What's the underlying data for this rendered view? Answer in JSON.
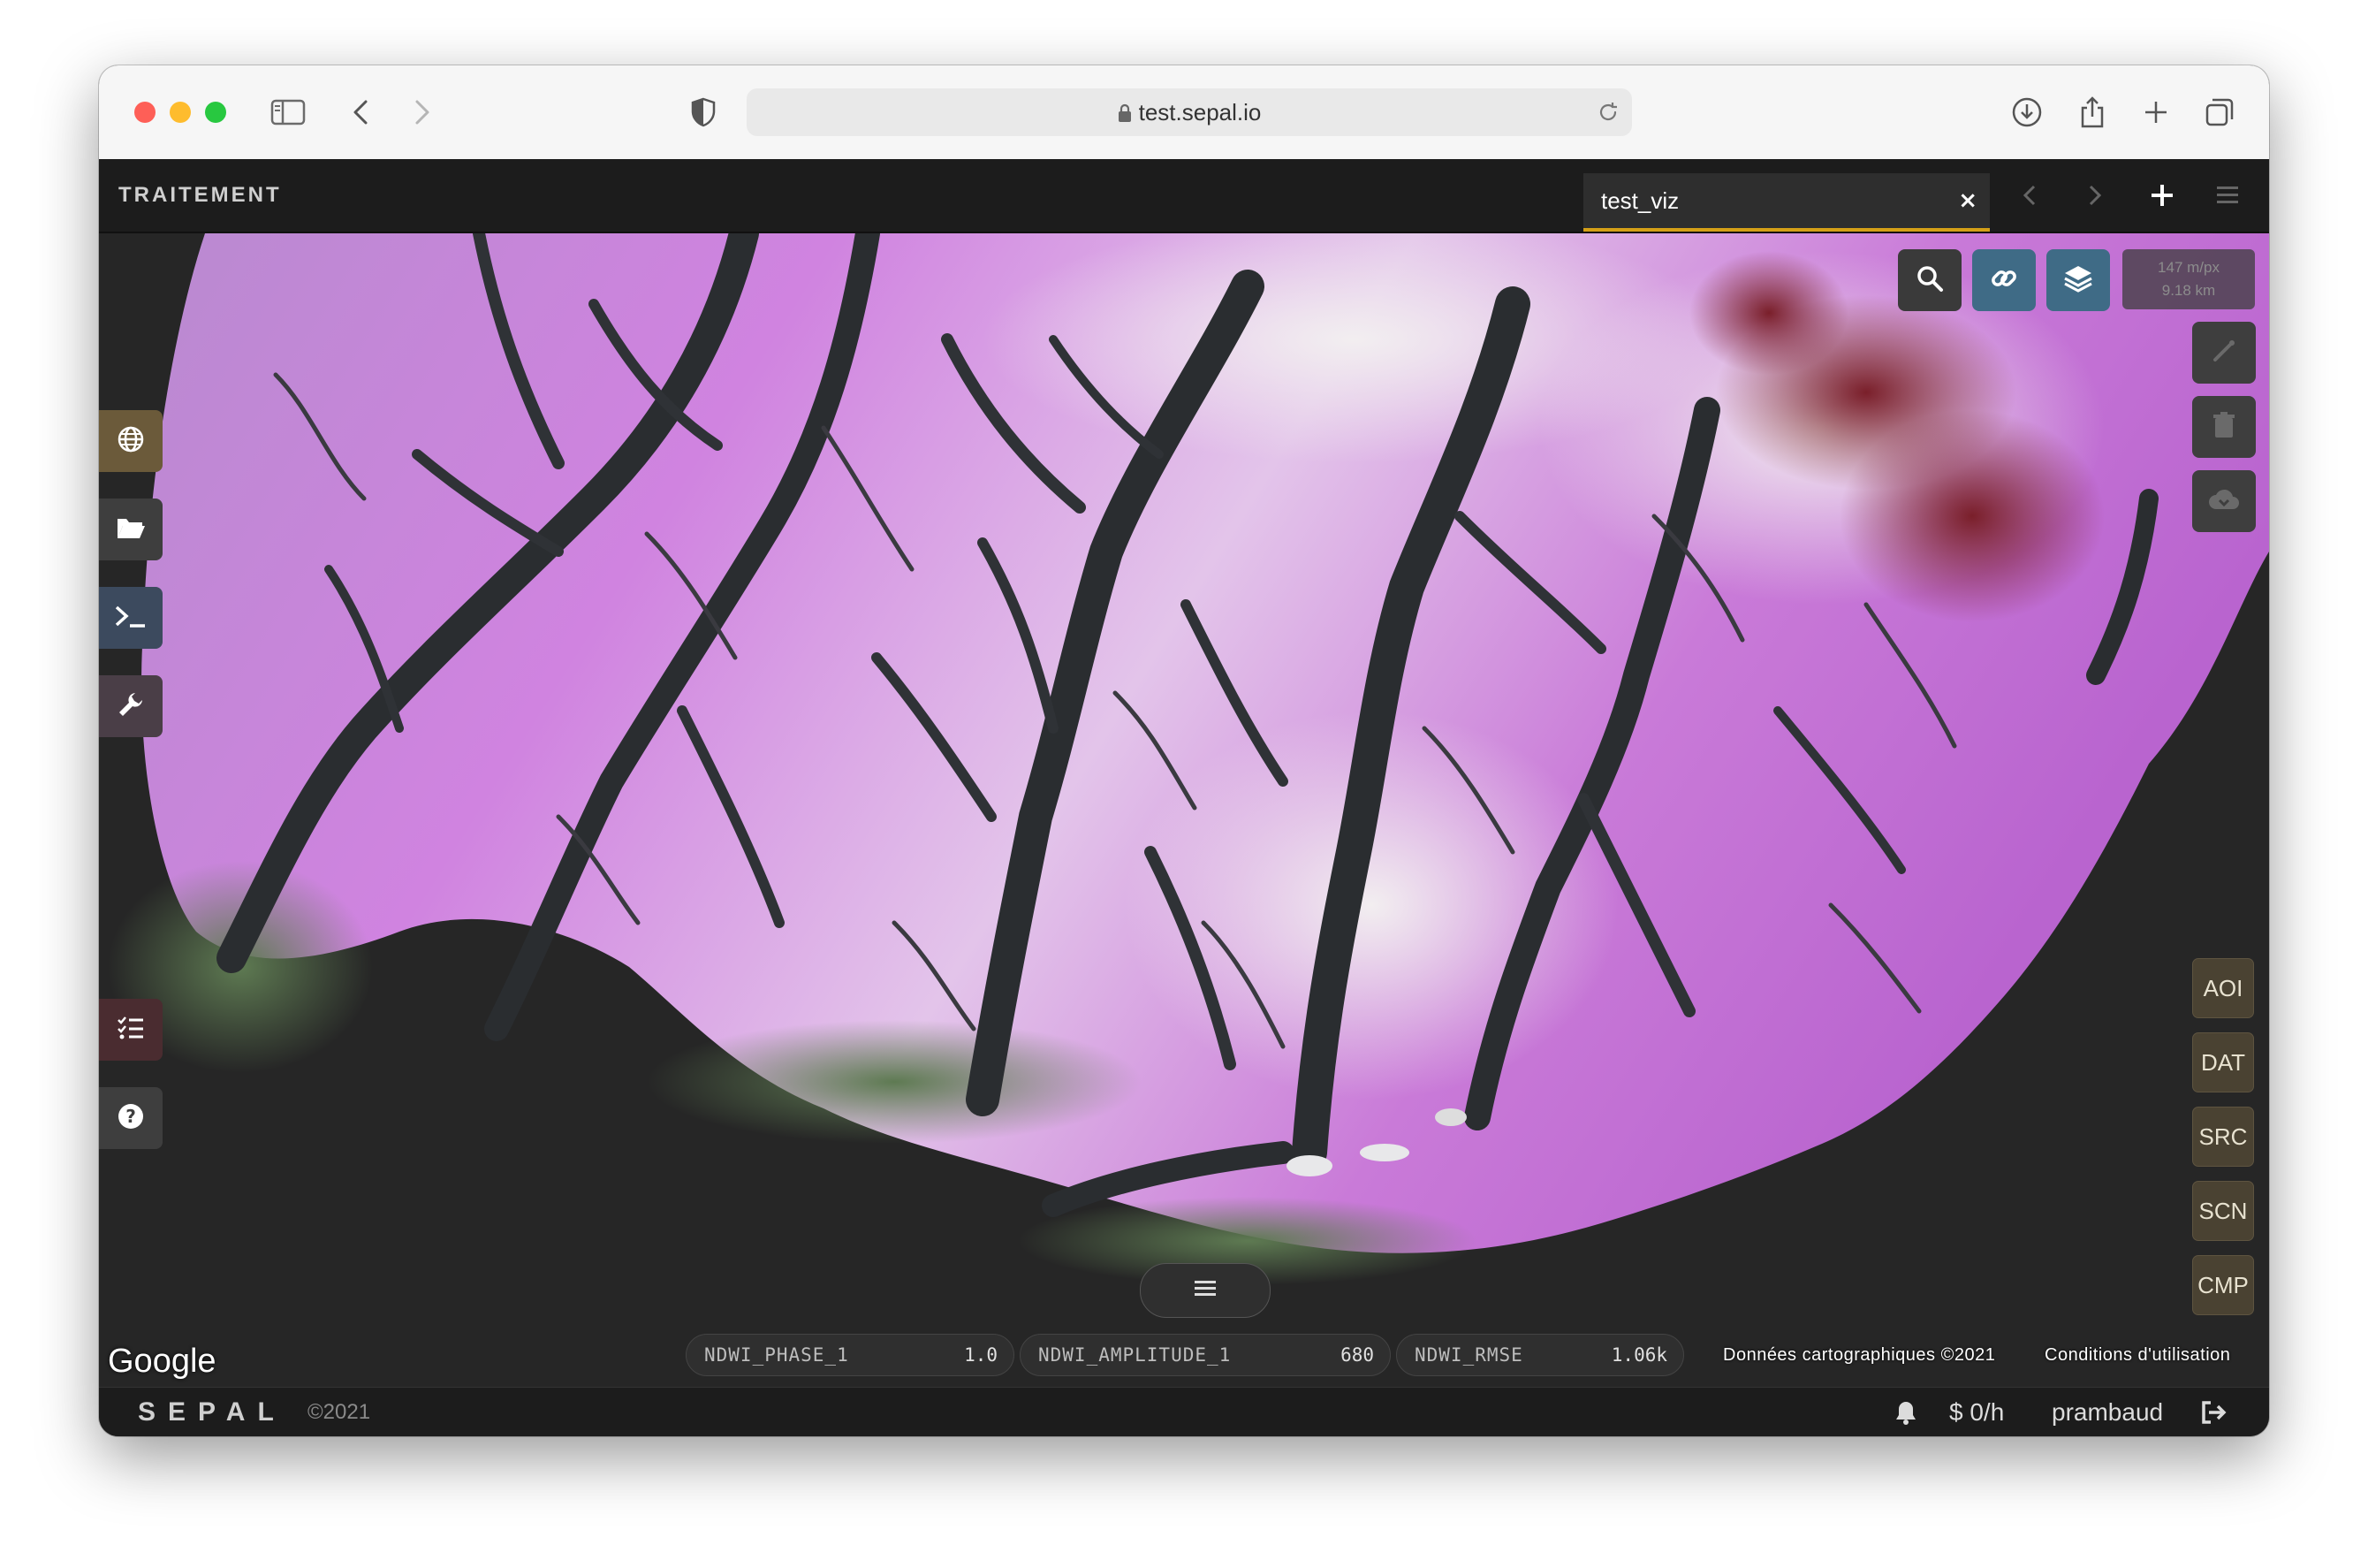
{
  "browser": {
    "url": "test.sepal.io",
    "icons": [
      "sidebar-icon",
      "back-icon",
      "forward-icon",
      "shield-icon",
      "lock-icon",
      "reload-icon",
      "download-icon",
      "share-icon",
      "new-tab-icon",
      "tabs-overview-icon"
    ]
  },
  "app": {
    "section_title": "TRAITEMENT",
    "tab": {
      "label": "test_viz",
      "close": "×"
    },
    "header_icons": [
      "chevron-left-icon",
      "chevron-right-icon",
      "plus-icon",
      "menu-icon"
    ]
  },
  "left_toolbar": [
    "globe-icon",
    "folder-icon",
    "terminal-icon",
    "wrench-icon",
    "task-list-icon",
    "help-icon"
  ],
  "map_toolbar": {
    "tools": [
      "search-icon",
      "link-icon",
      "layers-icon"
    ],
    "scale": {
      "resolution": "147 m/px",
      "distance": "9.18 km"
    },
    "side_tools": [
      "draw-icon",
      "trash-icon",
      "cloud-download-icon"
    ]
  },
  "recipe_panels": [
    "AOI",
    "DAT",
    "SRC",
    "SCN",
    "CMP"
  ],
  "legend_handle_icon": "hamburger-icon",
  "band_values": [
    {
      "name": "NDWI_PHASE_1",
      "value": "1.0"
    },
    {
      "name": "NDWI_AMPLITUDE_1",
      "value": "680"
    },
    {
      "name": "NDWI_RMSE",
      "value": "1.06k"
    }
  ],
  "map_footer": {
    "google": "Google",
    "data_attribution": "Données cartographiques ©2021",
    "terms": "Conditions d'utilisation"
  },
  "footer": {
    "brand": "SEPAL",
    "copyright": "©2021",
    "cost": "$ 0/h",
    "user": "prambaud"
  },
  "colors": {
    "accent": "#d4a017",
    "header_bg": "#1c1c1c",
    "map_water": "#262626",
    "land_magenta": "#c77ad9",
    "recipe_button": "#4a4232"
  }
}
